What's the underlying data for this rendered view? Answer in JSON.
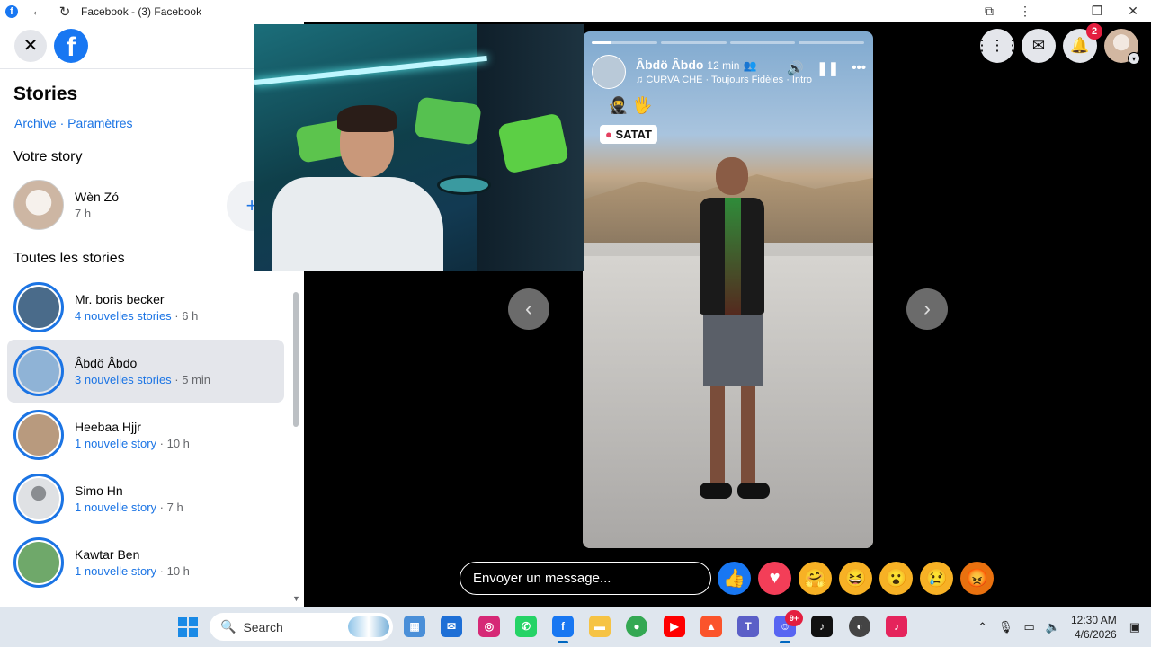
{
  "browser": {
    "tab_title": "Facebook - (3) Facebook",
    "back_icon": "arrow-left-icon",
    "reload_icon": "reload-icon"
  },
  "sidebar": {
    "heading": "Stories",
    "archive_link": "Archive",
    "separator": " · ",
    "settings_link": "Paramètres",
    "your_story_label": "Votre story",
    "your_story": {
      "name": "Wèn Zó",
      "meta": "7 h"
    },
    "all_stories_label": "Toutes les stories",
    "stories": [
      {
        "name": "Mr. boris becker",
        "count": "4 nouvelles stories",
        "time": " · 6 h"
      },
      {
        "name": "Âbdö Âbdo",
        "count": "3 nouvelles stories",
        "time": " · 5 min"
      },
      {
        "name": "Heebaa Hjjr",
        "count": "1 nouvelle story",
        "time": " · 10 h"
      },
      {
        "name": "Simo Hn",
        "count": "1 nouvelle story",
        "time": " · 7 h"
      },
      {
        "name": "Kawtar Ben",
        "count": "1 nouvelle story",
        "time": " · 10 h"
      }
    ]
  },
  "story_view": {
    "author": "Âbdö Âbdo",
    "time": "12 min",
    "music": "CURVA CHE · Toujours Fidèles · Intro",
    "sticker": "SATAT",
    "message_placeholder": "Envoyer un message..."
  },
  "header": {
    "notifications_count": "2"
  },
  "taskbar": {
    "search_label": "Search",
    "discord_badge": "9+",
    "time": "12:30 AM",
    "date": "4/6/2026"
  },
  "colors": {
    "facebook_blue": "#1877f2",
    "link_blue": "#1b74e4",
    "badge_red": "#e41e3f"
  }
}
